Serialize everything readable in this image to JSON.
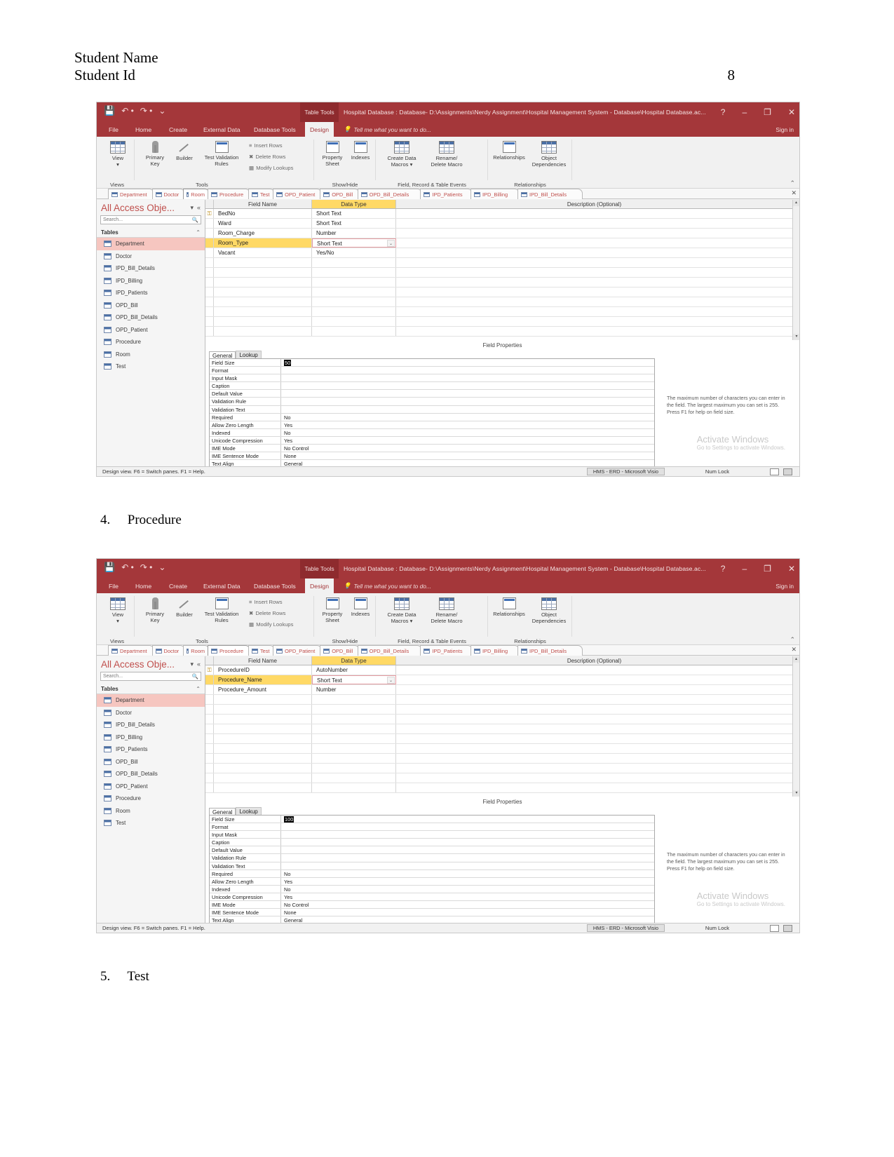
{
  "document": {
    "student_name": "Student Name",
    "student_id": "Student Id",
    "page_number": "8",
    "sections": [
      {
        "number": "4.",
        "title": "Procedure"
      },
      {
        "number": "5.",
        "title": "Test"
      }
    ]
  },
  "window": {
    "table_tools_label": "Table Tools",
    "title": "Hospital Database : Database- D:\\Assignments\\Nerdy Assignment\\Hospital Management System - Database\\Hospital Database.ac...",
    "help_icon": "?",
    "minimize_icon": "–",
    "restore_icon": "❐",
    "close_icon": "✕",
    "sign_in": "Sign in",
    "qat": {
      "save_icon": "save-icon",
      "undo_icon": "↶",
      "redo_icon": "↷",
      "customize_icon": "⌄"
    }
  },
  "ribbon": {
    "tabs": [
      {
        "label": "File",
        "active": false
      },
      {
        "label": "Home",
        "active": false
      },
      {
        "label": "Create",
        "active": false
      },
      {
        "label": "External Data",
        "active": false
      },
      {
        "label": "Database Tools",
        "active": false
      },
      {
        "label": "Design",
        "active": true
      }
    ],
    "tell_me": "Tell me what you want to do...",
    "tell_me_icon": "lightbulb-icon",
    "groups": [
      {
        "label": "Views",
        "items": [
          {
            "line1": "View",
            "line2": "▾",
            "icon": "table-view-icon"
          }
        ]
      },
      {
        "label": "Tools",
        "items": [
          {
            "line1": "Primary",
            "line2": "Key",
            "icon": "key-icon"
          },
          {
            "line1": "Builder",
            "line2": "",
            "icon": "builder-wand-icon"
          },
          {
            "line1": "Test Validation",
            "line2": "Rules",
            "icon": "validation-rules-icon"
          }
        ],
        "small_items": [
          {
            "label": "Insert Rows",
            "icon": "insert-rows-icon"
          },
          {
            "label": "Delete Rows",
            "icon": "delete-rows-icon"
          },
          {
            "label": "Modify Lookups",
            "icon": "modify-lookups-icon"
          }
        ]
      },
      {
        "label": "Show/Hide",
        "items": [
          {
            "line1": "Property",
            "line2": "Sheet",
            "icon": "property-sheet-icon"
          },
          {
            "line1": "Indexes",
            "line2": "",
            "icon": "indexes-icon"
          }
        ]
      },
      {
        "label": "Field, Record & Table Events",
        "items": [
          {
            "line1": "Create Data",
            "line2": "Macros ▾",
            "icon": "create-data-macros-icon"
          },
          {
            "line1": "Rename/",
            "line2": "Delete Macro",
            "icon": "rename-delete-macro-icon"
          }
        ]
      },
      {
        "label": "Relationships",
        "items": [
          {
            "line1": "Relationships",
            "line2": "",
            "icon": "relationships-icon"
          },
          {
            "line1": "Object",
            "line2": "Dependencies",
            "icon": "object-dependencies-icon"
          }
        ]
      }
    ],
    "collapse_icon": "⌃"
  },
  "object_tabs": {
    "close_icon": "✕",
    "tabs": [
      {
        "label": "Department",
        "active": false
      },
      {
        "label": "Doctor",
        "active": false
      },
      {
        "label": "Room",
        "active": true
      },
      {
        "label": "Procedure",
        "active": false
      },
      {
        "label": "Test",
        "active": false
      },
      {
        "label": "OPD_Patient",
        "active": false
      },
      {
        "label": "OPD_Bill",
        "active": false
      },
      {
        "label": "OPD_Bill_Details",
        "active": false
      },
      {
        "label": "IPD_Patients",
        "active": false
      },
      {
        "label": "IPD_Billing",
        "active": false
      },
      {
        "label": "IPD_Bill_Details",
        "active": false
      }
    ],
    "tabs2": [
      {
        "label": "Department",
        "active": false
      },
      {
        "label": "Doctor",
        "active": false
      },
      {
        "label": "Room",
        "active": false
      },
      {
        "label": "Procedure",
        "active": true
      },
      {
        "label": "Test",
        "active": false
      },
      {
        "label": "OPD_Patient",
        "active": false
      },
      {
        "label": "OPD_Bill",
        "active": false
      },
      {
        "label": "OPD_Bill_Details",
        "active": false
      },
      {
        "label": "IPD_Patients",
        "active": false
      },
      {
        "label": "IPD_Billing",
        "active": false
      },
      {
        "label": "IPD_Bill_Details",
        "active": false
      }
    ]
  },
  "nav_pane": {
    "title": "All Access Obje...",
    "dropdown_icon": "▾",
    "collapse_icon": "«",
    "search_placeholder": "Search...",
    "search_icon": "search-icon",
    "group_label": "Tables",
    "group_collapse_icon": "⌃",
    "items": [
      {
        "label": "Department",
        "selected": true
      },
      {
        "label": "Doctor",
        "selected": false
      },
      {
        "label": "IPD_Bill_Details",
        "selected": false
      },
      {
        "label": "IPD_Billing",
        "selected": false
      },
      {
        "label": "IPD_Patients",
        "selected": false
      },
      {
        "label": "OPD_Bill",
        "selected": false
      },
      {
        "label": "OPD_Bill_Details",
        "selected": false
      },
      {
        "label": "OPD_Patient",
        "selected": false
      },
      {
        "label": "Procedure",
        "selected": false
      },
      {
        "label": "Room",
        "selected": false
      },
      {
        "label": "Test",
        "selected": false
      }
    ]
  },
  "design_grid": {
    "headers": {
      "field_name": "Field Name",
      "data_type": "Data Type",
      "description": "Description (Optional)"
    },
    "room_rows": [
      {
        "key": "⚿",
        "field": "BedNo",
        "type": "Short Text",
        "selected": false
      },
      {
        "key": "",
        "field": "Ward",
        "type": "Short Text",
        "selected": false
      },
      {
        "key": "",
        "field": "Room_Charge",
        "type": "Number",
        "selected": false
      },
      {
        "key": "",
        "field": "Room_Type",
        "type": "Short Text",
        "selected": true
      },
      {
        "key": "",
        "field": "Vacant",
        "type": "Yes/No",
        "selected": false
      }
    ],
    "procedure_rows": [
      {
        "key": "⚿",
        "field": "ProcedureID",
        "type": "AutoNumber",
        "selected": false
      },
      {
        "key": "",
        "field": "Procedure_Name",
        "type": "Short Text",
        "selected": true
      },
      {
        "key": "",
        "field": "Procedure_Amount",
        "type": "Number",
        "selected": false
      }
    ],
    "dropdown_icon": "⌄",
    "scroll_up_icon": "▴",
    "scroll_down_icon": "▾"
  },
  "field_properties": {
    "panel_label": "Field Properties",
    "tabs": [
      {
        "label": "General",
        "active": true
      },
      {
        "label": "Lookup",
        "active": false
      }
    ],
    "rows_room": [
      {
        "key": "Field Size",
        "value": "50",
        "highlight": true
      },
      {
        "key": "Format",
        "value": ""
      },
      {
        "key": "Input Mask",
        "value": ""
      },
      {
        "key": "Caption",
        "value": ""
      },
      {
        "key": "Default Value",
        "value": ""
      },
      {
        "key": "Validation Rule",
        "value": ""
      },
      {
        "key": "Validation Text",
        "value": ""
      },
      {
        "key": "Required",
        "value": "No"
      },
      {
        "key": "Allow Zero Length",
        "value": "Yes"
      },
      {
        "key": "Indexed",
        "value": "No"
      },
      {
        "key": "Unicode Compression",
        "value": "Yes"
      },
      {
        "key": "IME Mode",
        "value": "No Control"
      },
      {
        "key": "IME Sentence Mode",
        "value": "None"
      },
      {
        "key": "Text Align",
        "value": "General"
      }
    ],
    "rows_procedure": [
      {
        "key": "Field Size",
        "value": "100",
        "highlight": true
      },
      {
        "key": "Format",
        "value": ""
      },
      {
        "key": "Input Mask",
        "value": ""
      },
      {
        "key": "Caption",
        "value": ""
      },
      {
        "key": "Default Value",
        "value": ""
      },
      {
        "key": "Validation Rule",
        "value": ""
      },
      {
        "key": "Validation Text",
        "value": ""
      },
      {
        "key": "Required",
        "value": "No"
      },
      {
        "key": "Allow Zero Length",
        "value": "Yes"
      },
      {
        "key": "Indexed",
        "value": "No"
      },
      {
        "key": "Unicode Compression",
        "value": "Yes"
      },
      {
        "key": "IME Mode",
        "value": "No Control"
      },
      {
        "key": "IME Sentence Mode",
        "value": "None"
      },
      {
        "key": "Text Align",
        "value": "General"
      }
    ],
    "help_text": "The maximum number of characters you can enter in the field. The largest maximum you can set is 255. Press F1 for help on field size."
  },
  "watermark": {
    "line1": "Activate Windows",
    "line2": "Go to Settings to activate Windows."
  },
  "status_bar": {
    "left": "Design view.  F6 = Switch panes.  F1 = Help.",
    "taskbar_item": "HMS - ERD - Microsoft Visio",
    "num_lock": "Num Lock",
    "view_datasheet_icon": "datasheet-view-icon",
    "view_design_icon": "design-view-icon"
  }
}
